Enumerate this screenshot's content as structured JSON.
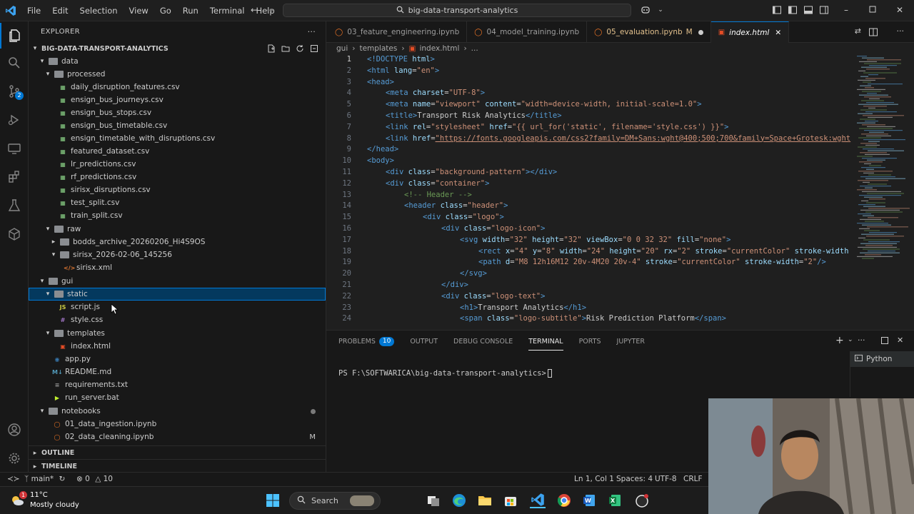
{
  "menu": [
    "File",
    "Edit",
    "Selection",
    "View",
    "Go",
    "Run",
    "Terminal",
    "Help"
  ],
  "command_center": "big-data-transport-analytics",
  "activity_bar": {
    "scm_badge": "2"
  },
  "explorer": {
    "title": "EXPLORER",
    "project": "BIG-DATA-TRANSPORT-ANALYTICS",
    "rows": [
      {
        "label": "data",
        "kind": "folder",
        "open": true
      },
      {
        "label": "processed",
        "kind": "folder",
        "open": true
      },
      {
        "label": "daily_disruption_features.csv",
        "kind": "csv"
      },
      {
        "label": "ensign_bus_journeys.csv",
        "kind": "csv"
      },
      {
        "label": "ensign_bus_stops.csv",
        "kind": "csv"
      },
      {
        "label": "ensign_bus_timetable.csv",
        "kind": "csv"
      },
      {
        "label": "ensign_timetable_with_disruptions.csv",
        "kind": "csv"
      },
      {
        "label": "featured_dataset.csv",
        "kind": "csv"
      },
      {
        "label": "lr_predictions.csv",
        "kind": "csv"
      },
      {
        "label": "rf_predictions.csv",
        "kind": "csv"
      },
      {
        "label": "sirisx_disruptions.csv",
        "kind": "csv"
      },
      {
        "label": "test_split.csv",
        "kind": "csv"
      },
      {
        "label": "train_split.csv",
        "kind": "csv"
      },
      {
        "label": "raw",
        "kind": "folder",
        "open": true
      },
      {
        "label": "bodds_archive_20260206_Hi4S9OS",
        "kind": "folder",
        "open": false
      },
      {
        "label": "sirisx_2026-02-06_145256",
        "kind": "folder",
        "open": true
      },
      {
        "label": "sirisx.xml",
        "kind": "xml"
      },
      {
        "label": "gui",
        "kind": "folder",
        "open": true
      },
      {
        "label": "static",
        "kind": "folder",
        "open": true
      },
      {
        "label": "script.js",
        "kind": "js"
      },
      {
        "label": "style.css",
        "kind": "css"
      },
      {
        "label": "templates",
        "kind": "folder",
        "open": true
      },
      {
        "label": "index.html",
        "kind": "html"
      },
      {
        "label": "app.py",
        "kind": "py"
      },
      {
        "label": "README.md",
        "kind": "md"
      },
      {
        "label": "requirements.txt",
        "kind": "txt"
      },
      {
        "label": "run_server.bat",
        "kind": "bat"
      },
      {
        "label": "notebooks",
        "kind": "folder",
        "open": true
      },
      {
        "label": "01_data_ingestion.ipynb",
        "kind": "ipynb"
      },
      {
        "label": "02_data_cleaning.ipynb",
        "kind": "ipynb",
        "badge": "M"
      }
    ],
    "outline": "OUTLINE",
    "timeline": "TIMELINE"
  },
  "tabs": [
    {
      "label": "03_feature_engineering.ipynb",
      "icon": "jupyter"
    },
    {
      "label": "04_model_training.ipynb",
      "icon": "jupyter"
    },
    {
      "label": "05_evaluation.ipynb",
      "icon": "jupyter",
      "modified": "M"
    },
    {
      "label": "index.html",
      "icon": "html",
      "active": true
    }
  ],
  "breadcrumb": [
    "gui",
    "templates",
    "index.html",
    "..."
  ],
  "code": [
    "1",
    "2",
    "3",
    "4",
    "5",
    "6",
    "7",
    "8",
    "9",
    "10",
    "11",
    "12",
    "13",
    "14",
    "15",
    "16",
    "17",
    "18",
    "19",
    "20",
    "21",
    "22",
    "23",
    "24"
  ],
  "code_text": {
    "l1a": "<!DOCTYPE",
    "l1b": " html",
    "l1c": ">",
    "l2a": "<html",
    "l2b": " lang",
    "l2c": "=",
    "l2d": "\"en\"",
    "l2e": ">",
    "l3": "<head>",
    "l4a": "<meta",
    "l4b": " charset",
    "l4c": "=",
    "l4d": "\"UTF-8\"",
    "l4e": ">",
    "l5a": "<meta",
    "l5b": " name",
    "l5c": "=",
    "l5d": "\"viewport\"",
    "l5e": " content",
    "l5f": "=",
    "l5g": "\"width=device-width, initial-scale=1.0\"",
    "l5h": ">",
    "l6a": "<title>",
    "l6b": "Transport Risk Analytics",
    "l6c": "</title>",
    "l7a": "<link",
    "l7b": " rel",
    "l7c": "=",
    "l7d": "\"stylesheet\"",
    "l7e": " href",
    "l7f": "=",
    "l7g": "\"{{ url_for('static', filename='style.css') }}\"",
    "l7h": ">",
    "l8a": "<link",
    "l8b": " href",
    "l8c": "=",
    "l8d": "\"https://fonts.googleapis.com/css2?family=DM+Sans:wght@400;500;700&family=Space+Grotesk:wght",
    "l9": "</head>",
    "l10": "<body>",
    "l11a": "<div",
    "l11b": " class",
    "l11c": "=",
    "l11d": "\"background-pattern\"",
    "l11e": "></div>",
    "l12a": "<div",
    "l12b": " class",
    "l12c": "=",
    "l12d": "\"container\"",
    "l12e": ">",
    "l13": "<!-- Header -->",
    "l14a": "<header",
    "l14b": " class",
    "l14c": "=",
    "l14d": "\"header\"",
    "l14e": ">",
    "l15a": "<div",
    "l15b": " class",
    "l15c": "=",
    "l15d": "\"logo\"",
    "l15e": ">",
    "l16a": "<div",
    "l16b": " class",
    "l16c": "=",
    "l16d": "\"logo-icon\"",
    "l16e": ">",
    "l17a": "<svg",
    "l17b": " width",
    "l17c": "=",
    "l17d": "\"32\"",
    "l17e": " height",
    "l17f": "=",
    "l17g": "\"32\"",
    "l17h": " viewBox",
    "l17i": "=",
    "l17j": "\"0 0 32 32\"",
    "l17k": " fill",
    "l17l": "=",
    "l17m": "\"none\"",
    "l17n": ">",
    "l18a": "<rect",
    "l18b": " x",
    "l18c": "=",
    "l18d": "\"4\"",
    "l18e": " y",
    "l18f": "=",
    "l18g": "\"8\"",
    "l18h": " width",
    "l18i": "=",
    "l18j": "\"24\"",
    "l18k": " height",
    "l18l": "=",
    "l18m": "\"20\"",
    "l18n": " rx",
    "l18o": "=",
    "l18p": "\"2\"",
    "l18q": " stroke",
    "l18r": "=",
    "l18s": "\"currentColor\"",
    "l18t": " stroke-width",
    "l19a": "<path",
    "l19b": " d",
    "l19c": "=",
    "l19d": "\"M8 12h16M12 20v-4M20 20v-4\"",
    "l19e": " stroke",
    "l19f": "=",
    "l19g": "\"currentColor\"",
    "l19h": " stroke-width",
    "l19i": "=",
    "l19j": "\"2\"",
    "l19k": "/>",
    "l20": "</svg>",
    "l21": "</div>",
    "l22a": "<div",
    "l22b": " class",
    "l22c": "=",
    "l22d": "\"logo-text\"",
    "l22e": ">",
    "l23a": "<h1>",
    "l23b": "Transport Analytics",
    "l23c": "</h1>",
    "l24a": "<span",
    "l24b": " class",
    "l24c": "=",
    "l24d": "\"logo-subtitle\"",
    "l24e": ">",
    "l24f": "Risk Prediction Platform",
    "l24g": "</span>"
  },
  "panel": {
    "tabs": [
      "PROBLEMS",
      "OUTPUT",
      "DEBUG CONSOLE",
      "TERMINAL",
      "PORTS",
      "JUPYTER"
    ],
    "problems_count": "10",
    "terminal_prompt": "PS F:\\SOFTWARICA\\big-data-transport-analytics>",
    "terminal_name": "Python"
  },
  "status": {
    "branch": "main*",
    "errors": "0",
    "warnings": "10",
    "position": "Ln 1, Col 1",
    "spaces": "Spaces: 4",
    "encoding": "UTF-8",
    "eol": "CRLF"
  },
  "taskbar": {
    "weather_temp": "11°C",
    "weather_desc": "Mostly cloudy",
    "weather_badge": "1",
    "search": "Search"
  },
  "colors": {
    "accent": "#0078d4",
    "html_icon": "#e44d26",
    "jupyter_icon": "#f37726",
    "modified": "#e2c08d"
  }
}
